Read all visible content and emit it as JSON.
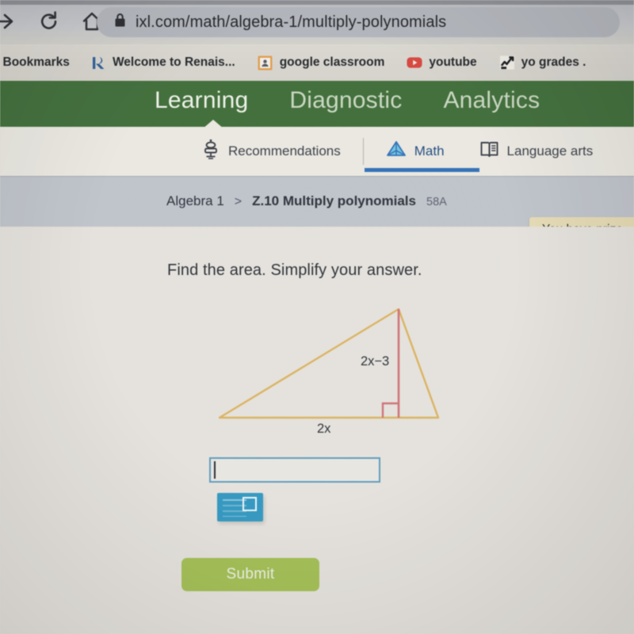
{
  "browser": {
    "nav_icons": [
      "forward-arrow-icon",
      "reload-icon",
      "home-icon"
    ],
    "omnibox": {
      "lock_icon": "lock-icon",
      "url": "ixl.com/math/algebra-1/multiply-polynomials"
    },
    "bookmarks": [
      {
        "label": "R Bookmarks",
        "icon": "folder-icon"
      },
      {
        "label": "Welcome to Renais...",
        "icon": "renaissance-r-icon"
      },
      {
        "label": "google classroom",
        "icon": "google-classroom-icon"
      },
      {
        "label": "youtube",
        "icon": "youtube-icon"
      },
      {
        "label": "yo grades .",
        "icon": "grades-icon"
      }
    ]
  },
  "site_nav": {
    "items": [
      {
        "label": "Learning",
        "active": true
      },
      {
        "label": "Diagnostic",
        "active": false
      },
      {
        "label": "Analytics",
        "active": false
      }
    ]
  },
  "subject_tabs": [
    {
      "label": "Recommendations",
      "icon": "robot-icon",
      "active": false
    },
    {
      "label": "Math",
      "icon": "pyramid-icon",
      "active": true
    },
    {
      "label": "Language arts",
      "icon": "open-book-icon",
      "active": false
    }
  ],
  "breadcrumb": {
    "course": "Algebra 1",
    "separator": ">",
    "skill": "Z.10 Multiply polynomials",
    "code": "58A"
  },
  "toast": {
    "text": "You have prize"
  },
  "question": {
    "prompt": "Find the area. Simplify your answer."
  },
  "figure": {
    "type": "triangle",
    "height_label": "2x−3",
    "base_label": "2x",
    "outline_color": "#e2b65c",
    "height_color": "#d9737b",
    "right_angle_marker": true
  },
  "answer": {
    "value": "",
    "placeholder": "",
    "exponent_button_label": "exponent-keypad"
  },
  "submit": {
    "label": "Submit",
    "color": "#a6c44f"
  }
}
